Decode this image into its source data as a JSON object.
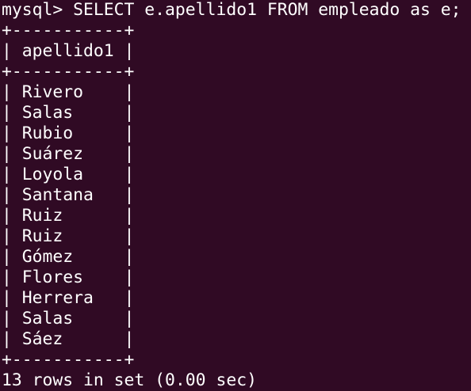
{
  "terminal": {
    "command_line": "mysql> SELECT e.apellido1 FROM empleado as e;",
    "border_line": "+-----------+",
    "header_row": "| apellido1 |",
    "rows": [
      "| Rivero    |",
      "| Salas     |",
      "| Rubio     |",
      "| Suárez    |",
      "| Loyola    |",
      "| Santana   |",
      "| Ruiz      |",
      "| Ruiz      |",
      "| Gómez     |",
      "| Flores    |",
      "| Herrera   |",
      "| Salas     |",
      "| Sáez      |"
    ],
    "result_summary": "13 rows in set (0.00 sec)"
  }
}
